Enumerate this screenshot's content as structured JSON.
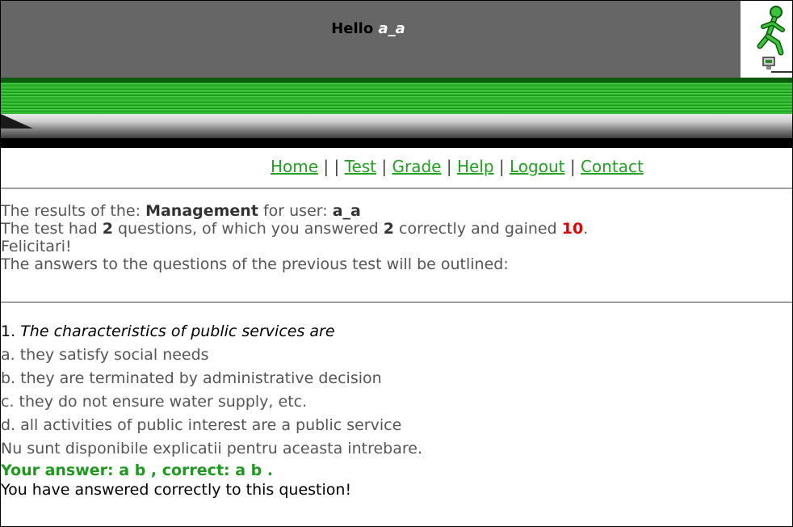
{
  "header": {
    "hello_prefix": "Hello",
    "username": "a_a"
  },
  "nav": {
    "items": [
      "Home",
      "Test",
      "Grade",
      "Help",
      "Logout",
      "Contact"
    ],
    "separators": [
      "| |",
      "|",
      "|",
      "|",
      "|"
    ]
  },
  "results": {
    "line1_prefix": "The results of the:",
    "subject": "Management",
    "line1_mid": "for user:",
    "user": "a_a",
    "line2_a": "The test had",
    "question_count": "2",
    "line2_b": "questions, of which you answered",
    "correct_count": "2",
    "line2_c": "correctly and gained",
    "score": "10",
    "line2_end": ".",
    "felicitari": "Felicitari!",
    "line4": "The answers to the questions of the previous test will be outlined:"
  },
  "question": {
    "number": "1.",
    "text": "The characteristics of public services are",
    "options": [
      "a. they satisfy social needs",
      "b. they are terminated by administrative decision",
      "c. they do not ensure water supply, etc.",
      "d. all activities of public interest are a public service"
    ],
    "explanation": "Nu sunt disponibile explicatii pentru aceasta intrebare.",
    "your_answer": "Your answer: a b , correct: a b .",
    "result_msg": "You have answered correctly to this question!"
  },
  "colors": {
    "link_green": "#23a123",
    "answer_green": "#1d9a1d",
    "score_red": "#e00000",
    "header_grey": "#666666"
  },
  "icons": {
    "logo": "running-man-logo-icon"
  }
}
